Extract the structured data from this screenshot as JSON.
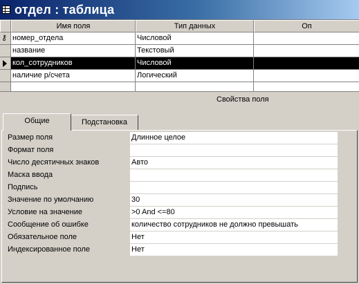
{
  "window": {
    "title": "отдел : таблица",
    "icon": "table-icon"
  },
  "grid": {
    "headers": [
      "Имя поля",
      "Тип данных",
      "Оп"
    ],
    "rows": [
      {
        "name": "номер_отдела",
        "type": "Числовой",
        "description": "",
        "marker": "key-icon"
      },
      {
        "name": "название",
        "type": "Текстовый",
        "description": ""
      },
      {
        "name": "кол_сотрудников",
        "type": "Числовой",
        "description": "",
        "marker": "arrow-icon",
        "selected": true
      },
      {
        "name": "наличие р/счета",
        "type": "Логический",
        "description": ""
      },
      {
        "name": "",
        "type": "",
        "description": ""
      }
    ]
  },
  "properties": {
    "title": "Свойства поля",
    "tabs": [
      "Общие",
      "Подстановка"
    ],
    "active_tab": "Общие",
    "rows": [
      {
        "label": "Размер поля",
        "value": "Длинное целое"
      },
      {
        "label": "Формат поля",
        "value": ""
      },
      {
        "label": "Число десятичных знаков",
        "value": "Авто"
      },
      {
        "label": "Маска ввода",
        "value": ""
      },
      {
        "label": "Подпись",
        "value": ""
      },
      {
        "label": "Значение по умолчанию",
        "value": "30"
      },
      {
        "label": "Условие на значение",
        "value": ">0 And <=80"
      },
      {
        "label": "Сообщение об ошибке",
        "value": "количество сотрудников не должно превышать"
      },
      {
        "label": "Обязательное поле",
        "value": "Нет"
      },
      {
        "label": "Индексированное поле",
        "value": "Нет"
      }
    ]
  }
}
